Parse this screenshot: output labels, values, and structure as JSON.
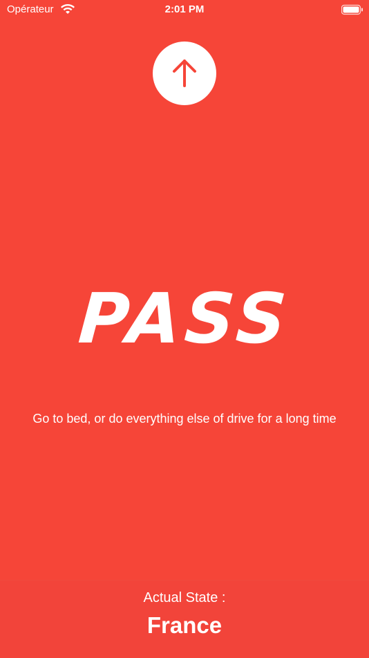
{
  "status_bar": {
    "carrier": "Opérateur",
    "time": "2:01 PM",
    "wifi_icon": "wifi-icon",
    "battery_icon": "battery-icon"
  },
  "main": {
    "up_button_icon": "arrow-up-icon",
    "state_word": "PASS",
    "description": "Go to bed, or do everything else of drive for a long time"
  },
  "footer": {
    "label": "Actual State :",
    "country": "France"
  },
  "colors": {
    "background": "#f64538",
    "accent": "#ffffff",
    "arrow": "#f64538"
  }
}
